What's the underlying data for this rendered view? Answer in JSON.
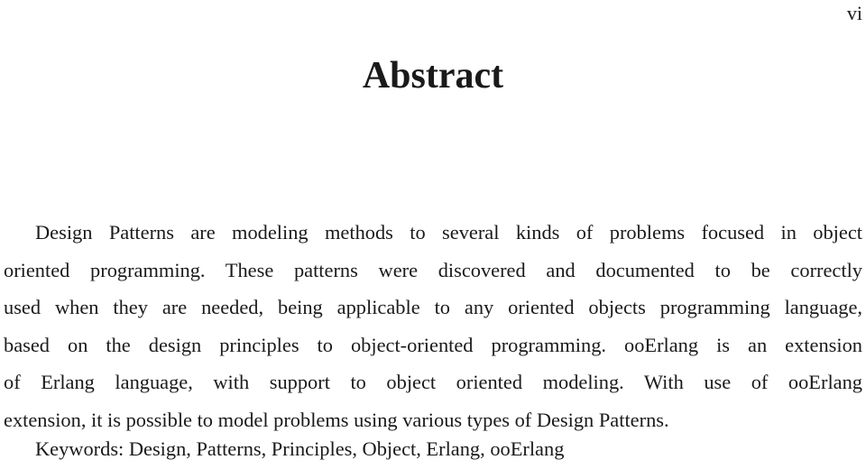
{
  "page": {
    "number": "vi",
    "title": "Abstract"
  },
  "abstract": {
    "lines": [
      "Design Patterns are modeling methods to several kinds of problems focused in object",
      "oriented programming.  These patterns were discovered and documented to be correctly",
      "used when they are needed, being applicable to any oriented objects programming language,",
      "based on the design principles to object-oriented programming. ooErlang is an extension",
      "of Erlang language, with support to object oriented modeling.  With use of ooErlang",
      "extension, it is possible to model problems using various types of Design Patterns."
    ]
  },
  "keywords": "Keywords: Design, Patterns, Principles, Object, Erlang, ooErlang"
}
